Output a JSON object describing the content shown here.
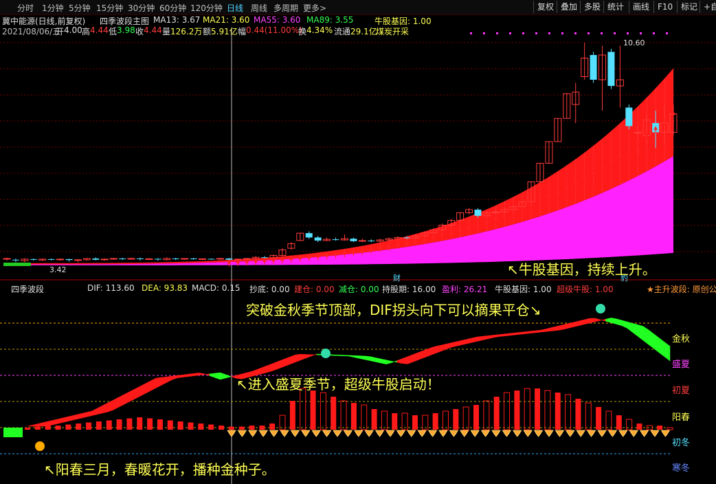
{
  "toolbar": {
    "periods": [
      "分时",
      "1分钟",
      "5分钟",
      "15分钟",
      "30分钟",
      "60分钟",
      "120分钟",
      "日线",
      "周线",
      "多周期",
      "更多>"
    ],
    "active_period": "日线",
    "right_buttons": [
      "复权",
      "叠加",
      "多股",
      "统计",
      "画线",
      "F10",
      "标记",
      "+自"
    ]
  },
  "main_header": {
    "stock": "冀中能源(日线,前复权)",
    "formula": "四季波段主图",
    "ma13": "MA13: 3.67",
    "ma21": "MA21: 3.60",
    "ma55": "MA55: 3.60",
    "ma89": "MA89: 3.55",
    "gene": "牛股基因: 1.00"
  },
  "info_line": {
    "date": "2021/08/06/五",
    "open_label": "开",
    "open": "4.00",
    "high_label": "高",
    "high": "4.44",
    "low_label": "低",
    "low": "3.98",
    "close_label": "收",
    "close": "4.44",
    "vol_label": "量",
    "vol": "126.2万",
    "amt_label": "额",
    "amt": "5.91亿",
    "chg_label": "幅",
    "chg": "0.44(11.00%)",
    "turn_label": "换",
    "turn": "4.34%",
    "float_label": "流通",
    "float": "29.1亿",
    "concept": "煤炭开采"
  },
  "price_labels": {
    "high_mark": "10.60",
    "low_mark": "3.42",
    "fin_mark": "财",
    "bao_mark": "豹"
  },
  "annotations": {
    "gene_up": "↖牛股基因，持续上升。",
    "breakthrough": "突破金秋季节顶部，DIF拐头向下可以摘果平仓↘",
    "summer": "↖进入盛夏季节，超级牛股启动！",
    "spring": "↖阳春三月，春暖花开，播种金种子。"
  },
  "sub_header": {
    "name": "四季波段",
    "dif": "DIF: 113.60",
    "dea": "DEA: 93.83",
    "macd": "MACD: 0.15",
    "chaodi": "抄底: 0.00",
    "jiancang": "建仓: 0.00",
    "jiancang2": "减仓: 0.00",
    "hold": "持股期: 16.00",
    "profit": "盈利: 26.21",
    "gene": "牛股基因: 1.00",
    "super": "超级牛股: 1.00",
    "wave": "★主升波段: 原创公"
  },
  "seasons": [
    "金秋",
    "盛夏",
    "初夏",
    "阳春",
    "初冬",
    "寒冬"
  ],
  "colors": {
    "up": "#ff3c3c",
    "down": "#55e0ff",
    "band_red": "#ff1a1a",
    "band_magenta": "#ff22ff",
    "band_green": "#22ff22",
    "grid": "#7a0000"
  },
  "candles": [
    {
      "o": 3.6,
      "c": 3.62,
      "h": 3.65,
      "l": 3.55
    },
    {
      "o": 3.58,
      "c": 3.56,
      "h": 3.62,
      "l": 3.5
    },
    {
      "o": 3.55,
      "c": 3.6,
      "h": 3.63,
      "l": 3.5
    },
    {
      "o": 3.6,
      "c": 3.58,
      "h": 3.62,
      "l": 3.55
    },
    {
      "o": 3.57,
      "c": 3.6,
      "h": 3.62,
      "l": 3.54
    },
    {
      "o": 3.6,
      "c": 3.59,
      "h": 3.62,
      "l": 3.56
    },
    {
      "o": 3.58,
      "c": 3.6,
      "h": 3.62,
      "l": 3.55
    },
    {
      "o": 3.6,
      "c": 3.57,
      "h": 3.61,
      "l": 3.52
    },
    {
      "o": 3.57,
      "c": 3.58,
      "h": 3.6,
      "l": 3.5
    },
    {
      "o": 3.58,
      "c": 3.62,
      "h": 3.64,
      "l": 3.55
    },
    {
      "o": 3.62,
      "c": 3.58,
      "h": 3.66,
      "l": 3.56
    },
    {
      "o": 3.58,
      "c": 3.6,
      "h": 3.62,
      "l": 3.55
    },
    {
      "o": 3.6,
      "c": 3.62,
      "h": 3.64,
      "l": 3.58
    },
    {
      "o": 3.62,
      "c": 3.6,
      "h": 3.64,
      "l": 3.57
    },
    {
      "o": 3.6,
      "c": 3.62,
      "h": 3.65,
      "l": 3.58
    },
    {
      "o": 3.62,
      "c": 3.6,
      "h": 3.65,
      "l": 3.56
    },
    {
      "o": 3.6,
      "c": 3.61,
      "h": 3.63,
      "l": 3.57
    },
    {
      "o": 3.61,
      "c": 3.59,
      "h": 3.63,
      "l": 3.55
    },
    {
      "o": 3.58,
      "c": 3.62,
      "h": 3.66,
      "l": 3.56
    },
    {
      "o": 3.62,
      "c": 3.6,
      "h": 3.64,
      "l": 3.57
    },
    {
      "o": 3.6,
      "c": 3.62,
      "h": 3.63,
      "l": 3.58
    },
    {
      "o": 3.62,
      "c": 3.6,
      "h": 3.64,
      "l": 3.58
    },
    {
      "o": 3.6,
      "c": 3.61,
      "h": 3.63,
      "l": 3.57
    },
    {
      "o": 3.61,
      "c": 3.6,
      "h": 3.62,
      "l": 3.58
    },
    {
      "o": 3.6,
      "c": 3.62,
      "h": 3.64,
      "l": 3.58
    },
    {
      "o": 3.62,
      "c": 3.58,
      "h": 3.64,
      "l": 3.55
    },
    {
      "o": 3.58,
      "c": 3.6,
      "h": 3.62,
      "l": 3.56
    },
    {
      "o": 3.6,
      "c": 3.62,
      "h": 3.64,
      "l": 3.58
    },
    {
      "o": 3.62,
      "c": 3.66,
      "h": 3.7,
      "l": 3.6
    },
    {
      "o": 3.66,
      "c": 3.64,
      "h": 3.7,
      "l": 3.62
    },
    {
      "o": 3.64,
      "c": 3.72,
      "h": 3.75,
      "l": 3.62
    },
    {
      "o": 3.72,
      "c": 3.9,
      "h": 3.95,
      "l": 3.7
    },
    {
      "o": 3.95,
      "c": 4.1,
      "h": 4.15,
      "l": 3.9
    },
    {
      "o": 4.2,
      "c": 4.44,
      "h": 4.44,
      "l": 4.18
    },
    {
      "o": 4.44,
      "c": 4.3,
      "h": 4.5,
      "l": 4.25
    },
    {
      "o": 4.3,
      "c": 4.2,
      "h": 4.35,
      "l": 4.15
    },
    {
      "o": 4.2,
      "c": 4.24,
      "h": 4.3,
      "l": 4.18
    },
    {
      "o": 4.24,
      "c": 4.22,
      "h": 4.3,
      "l": 4.2
    },
    {
      "o": 4.22,
      "c": 4.26,
      "h": 4.4,
      "l": 4.2
    },
    {
      "o": 4.26,
      "c": 4.18,
      "h": 4.3,
      "l": 4.15
    },
    {
      "o": 4.18,
      "c": 4.2,
      "h": 4.26,
      "l": 4.15
    },
    {
      "o": 4.2,
      "c": 4.18,
      "h": 4.24,
      "l": 4.15
    },
    {
      "o": 4.18,
      "c": 4.22,
      "h": 4.26,
      "l": 4.15
    },
    {
      "o": 4.22,
      "c": 4.26,
      "h": 4.3,
      "l": 4.2
    },
    {
      "o": 4.26,
      "c": 4.3,
      "h": 4.34,
      "l": 4.24
    },
    {
      "o": 4.3,
      "c": 4.28,
      "h": 4.34,
      "l": 4.25
    },
    {
      "o": 4.28,
      "c": 4.35,
      "h": 4.4,
      "l": 4.26
    },
    {
      "o": 4.35,
      "c": 4.45,
      "h": 4.5,
      "l": 4.33
    },
    {
      "o": 4.45,
      "c": 4.55,
      "h": 4.6,
      "l": 4.42
    },
    {
      "o": 4.55,
      "c": 4.7,
      "h": 4.75,
      "l": 4.5
    },
    {
      "o": 4.7,
      "c": 4.85,
      "h": 4.9,
      "l": 4.68
    },
    {
      "o": 4.85,
      "c": 5.1,
      "h": 5.12,
      "l": 4.82
    },
    {
      "o": 5.1,
      "c": 5.2,
      "h": 5.25,
      "l": 5.05
    },
    {
      "o": 5.2,
      "c": 5.0,
      "h": 5.25,
      "l": 4.95
    },
    {
      "o": 5.0,
      "c": 5.1,
      "h": 5.15,
      "l": 4.98
    },
    {
      "o": 5.1,
      "c": 5.12,
      "h": 5.18,
      "l": 5.05
    },
    {
      "o": 5.12,
      "c": 5.2,
      "h": 5.25,
      "l": 5.1
    },
    {
      "o": 5.2,
      "c": 5.3,
      "h": 5.35,
      "l": 5.18
    },
    {
      "o": 5.3,
      "c": 5.45,
      "h": 5.5,
      "l": 5.28
    },
    {
      "o": 5.45,
      "c": 6.1,
      "h": 6.1,
      "l": 5.45
    },
    {
      "o": 6.1,
      "c": 6.7,
      "h": 6.7,
      "l": 6.1
    },
    {
      "o": 6.7,
      "c": 7.4,
      "h": 7.4,
      "l": 6.7
    },
    {
      "o": 7.4,
      "c": 8.15,
      "h": 8.15,
      "l": 7.4
    },
    {
      "o": 8.15,
      "c": 8.95,
      "h": 8.95,
      "l": 8.15
    },
    {
      "o": 8.6,
      "c": 9.0,
      "h": 9.3,
      "l": 8.0
    },
    {
      "o": 9.5,
      "c": 10.1,
      "h": 10.6,
      "l": 9.4
    },
    {
      "o": 10.2,
      "c": 9.4,
      "h": 10.3,
      "l": 9.3
    },
    {
      "o": 9.4,
      "c": 10.2,
      "h": 10.5,
      "l": 8.4
    },
    {
      "o": 10.3,
      "c": 9.2,
      "h": 10.4,
      "l": 9.1
    },
    {
      "o": 9.2,
      "c": 9.4,
      "h": 10.5,
      "l": 8.5
    },
    {
      "o": 8.5,
      "c": 7.9,
      "h": 8.6,
      "l": 7.8
    },
    {
      "o": 7.7,
      "c": 7.7,
      "h": 7.9,
      "l": 7.0
    },
    {
      "o": 7.6,
      "c": 8.1,
      "h": 8.3,
      "l": 7.3
    },
    {
      "o": 8.0,
      "c": 7.7,
      "h": 8.4,
      "l": 7.2
    },
    {
      "o": 7.7,
      "c": 8.0,
      "h": 8.6,
      "l": 7.3
    },
    {
      "o": 7.7,
      "c": 8.3,
      "h": 8.6,
      "l": 7.6
    }
  ],
  "macd_bars": [
    2,
    3,
    4,
    4,
    5,
    6,
    7,
    8,
    9,
    10,
    11,
    12,
    11,
    10,
    9,
    8,
    7,
    6,
    5,
    4,
    3,
    3,
    4,
    4,
    6,
    14,
    28,
    40,
    38,
    36,
    32,
    28,
    26,
    24,
    20,
    18,
    16,
    16,
    14,
    14,
    16,
    18,
    20,
    22,
    24,
    28,
    32,
    36,
    38,
    40,
    40,
    38,
    36,
    34,
    30,
    26,
    22,
    18,
    14,
    10,
    6,
    4,
    4,
    2
  ]
}
